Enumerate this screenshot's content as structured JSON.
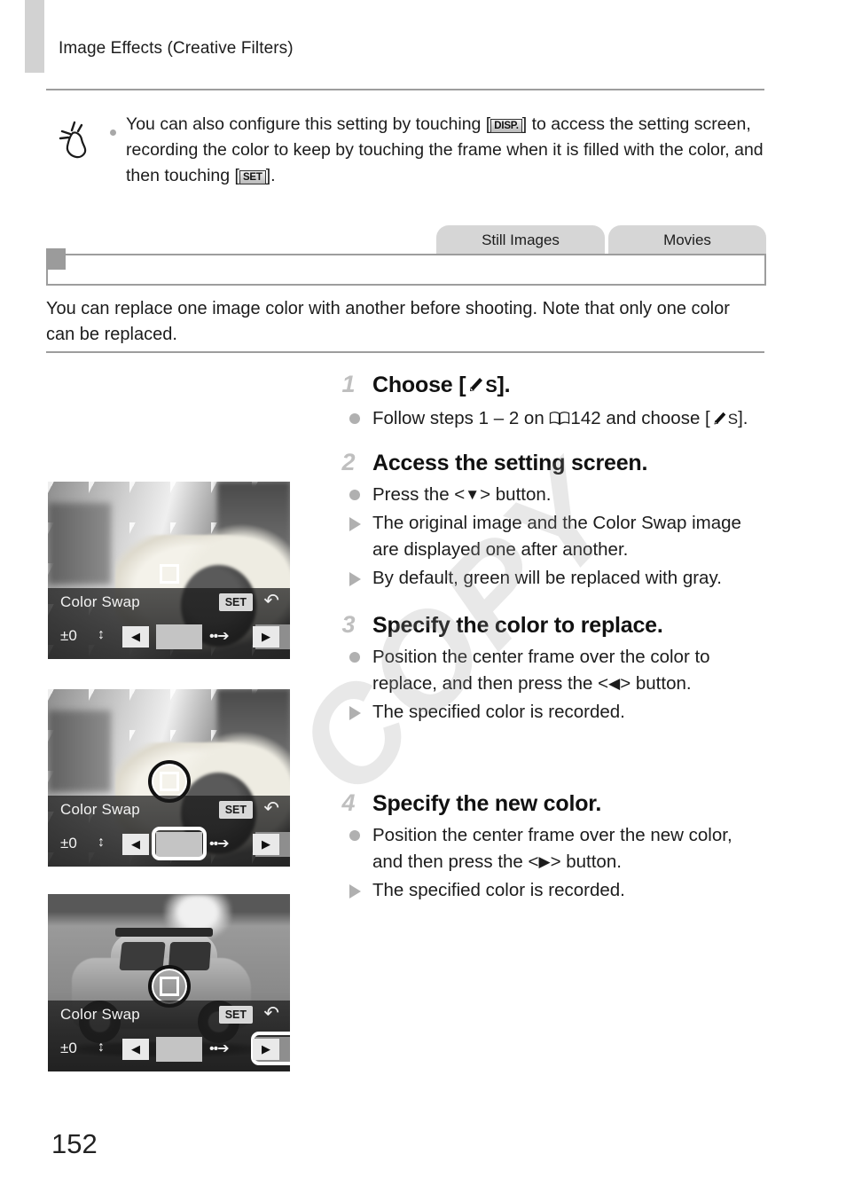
{
  "document": {
    "running_header": "Image Effects (Creative Filters)",
    "page_number": "152"
  },
  "tip": {
    "icon": "touch-hand-icon",
    "text_part1": "You can also configure this setting by touching [",
    "key_disp": "DISP.",
    "text_part2": "] to access the setting screen, recording the color to keep by touching the frame when it is filled with the color, and then touching [",
    "key_set": "SET",
    "text_part3": "]."
  },
  "mode_tabs": [
    {
      "label": "Still Images"
    },
    {
      "label": "Movies"
    }
  ],
  "section": {
    "title": "",
    "intro": "You can replace one image color with another before shooting. Note that only one color can be replaced."
  },
  "steps": [
    {
      "number": "1",
      "heading_prefix": "Choose [",
      "heading_icon": "color-swap-icon",
      "heading_suffix": "].",
      "items": [
        {
          "marker": "dot",
          "text_before": "Follow steps 1 – 2 on ",
          "book_icon": "book-icon",
          "page_ref": "142",
          "text_after": " and choose [",
          "inline_icon": "color-swap-icon",
          "text_end": "]."
        }
      ]
    },
    {
      "number": "2",
      "heading": "Access the setting screen.",
      "items": [
        {
          "marker": "dot",
          "text_before": "Press the <",
          "arrow": "▼",
          "text_after": "> button."
        },
        {
          "marker": "tri",
          "text": "The original image and the Color Swap image are displayed one after another."
        },
        {
          "marker": "tri",
          "text": "By default, green will be replaced with gray."
        }
      ]
    },
    {
      "number": "3",
      "heading": "Specify the color to replace.",
      "items": [
        {
          "marker": "dot",
          "text_before": "Position the center frame over the color to replace, and then press the <",
          "arrow": "◀",
          "text_after": "> button."
        },
        {
          "marker": "tri",
          "text": "The specified color is recorded."
        }
      ]
    },
    {
      "number": "4",
      "heading": "Specify the new color.",
      "items": [
        {
          "marker": "dot",
          "text_before": "Position the center frame over the new color, and then press the <",
          "arrow": "▶",
          "text_after": "> button."
        },
        {
          "marker": "tri",
          "text": "The specified color is recorded."
        }
      ]
    }
  ],
  "screenshots": [
    {
      "scene": "sunflower",
      "osd_title": "Color Swap",
      "osd_set": "SET",
      "osd_back": "↶",
      "osd_ev": "±0",
      "osd_updown": "↕",
      "left_arrow": "◀",
      "right_arrow": "▶",
      "dots_arrow": "••➔",
      "swatch_from": "#c4c4c4",
      "swatch_to": "#8e8e8e",
      "highlight": "none",
      "center_ring": false
    },
    {
      "scene": "sunflower",
      "osd_title": "Color Swap",
      "osd_set": "SET",
      "osd_back": "↶",
      "osd_ev": "±0",
      "osd_updown": "↕",
      "left_arrow": "◀",
      "right_arrow": "▶",
      "dots_arrow": "••➔",
      "swatch_from": "#c4c4c4",
      "swatch_to": "#8e8e8e",
      "highlight": "from",
      "center_ring": true
    },
    {
      "scene": "car",
      "osd_title": "Color Swap",
      "osd_set": "SET",
      "osd_back": "↶",
      "osd_ev": "±0",
      "osd_updown": "↕",
      "left_arrow": "◀",
      "right_arrow": "▶",
      "dots_arrow": "••➔",
      "swatch_from": "#c4c4c4",
      "swatch_to": "#8e8e8e",
      "highlight": "to",
      "center_ring": true
    }
  ],
  "watermark": {
    "text": "COPY"
  },
  "colors": {
    "rule": "#9d9d9d",
    "tab_gray": "#d6d6d6",
    "edge_tab": "#d2d2d2",
    "step_number": "#bfbfbf",
    "marker": "#b0b0b0"
  }
}
